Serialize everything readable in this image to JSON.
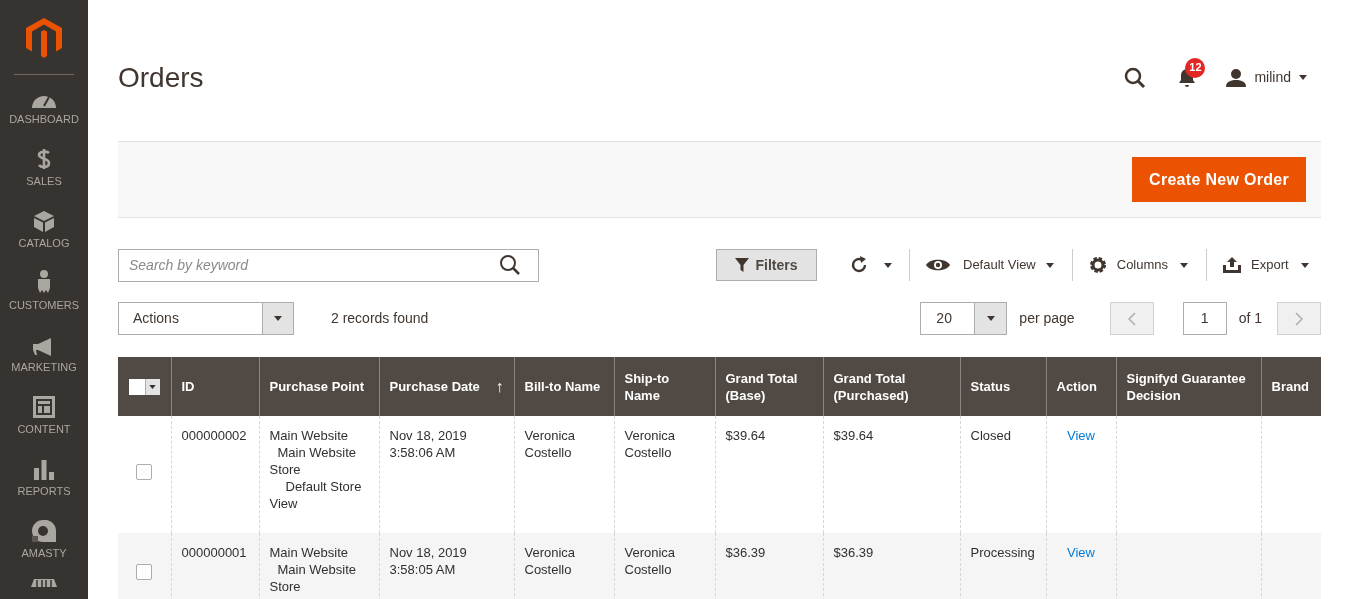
{
  "sidebar": {
    "items": [
      {
        "label": "DASHBOARD"
      },
      {
        "label": "SALES"
      },
      {
        "label": "CATALOG"
      },
      {
        "label": "CUSTOMERS"
      },
      {
        "label": "MARKETING"
      },
      {
        "label": "CONTENT"
      },
      {
        "label": "REPORTS"
      },
      {
        "label": "AMASTY"
      }
    ]
  },
  "header": {
    "title": "Orders",
    "notifications": "12",
    "user": "milind"
  },
  "page_actions": {
    "primary": "Create New Order"
  },
  "toolbar": {
    "search_placeholder": "Search by keyword",
    "filters": "Filters",
    "view": "Default View",
    "columns": "Columns",
    "export": "Export"
  },
  "grid_controls": {
    "actions": "Actions",
    "records": "2 records found",
    "per_page": "20",
    "per_page_label": "per page",
    "page": "1",
    "of_pages": "of 1"
  },
  "table": {
    "columns": [
      {
        "label": "ID"
      },
      {
        "label": "Purchase Point"
      },
      {
        "label": "Purchase Date",
        "sort_icon": "↑"
      },
      {
        "label": "Bill-to Name"
      },
      {
        "label": "Ship-to Name"
      },
      {
        "label": "Grand Total (Base)"
      },
      {
        "label": "Grand Total (Purchased)"
      },
      {
        "label": "Status"
      },
      {
        "label": "Action"
      },
      {
        "label": "Signifyd Guarantee Decision"
      },
      {
        "label": "Brand"
      }
    ],
    "rows": [
      {
        "selected": false,
        "id": "000000002",
        "purchase_point": [
          "Main Website",
          "Main Website Store",
          "Default Store View"
        ],
        "purchase_date": "Nov 18, 2019 3:58:06 AM",
        "bill_to": "Veronica Costello",
        "ship_to": "Veronica Costello",
        "total_base": "$39.64",
        "total_purchased": "$39.64",
        "status": "Closed",
        "action": "View"
      },
      {
        "selected": false,
        "id": "000000001",
        "purchase_point": [
          "Main Website",
          "Main Website Store"
        ],
        "purchase_date": "Nov 18, 2019 3:58:05 AM",
        "bill_to": "Veronica Costello",
        "ship_to": "Veronica Costello",
        "total_base": "$36.39",
        "total_purchased": "$36.39",
        "status": "Processing",
        "action": "View"
      }
    ]
  }
}
